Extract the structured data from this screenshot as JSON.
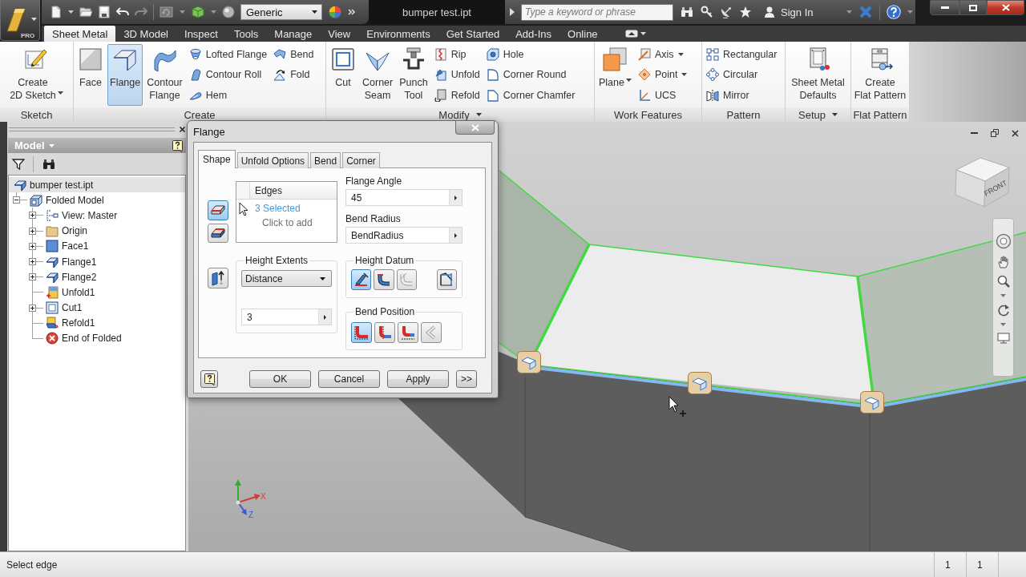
{
  "title_bar": {
    "app_badge": "PRO",
    "material": "Generic",
    "document_title": "bumper test.ipt",
    "search": {
      "placeholder": "Type a keyword or phrase"
    },
    "sign_in": "Sign In"
  },
  "ribbon_tabs": [
    {
      "label": "Sheet Metal",
      "selected": true
    },
    {
      "label": "3D Model",
      "selected": false
    },
    {
      "label": "Inspect",
      "selected": false
    },
    {
      "label": "Tools",
      "selected": false
    },
    {
      "label": "Manage",
      "selected": false
    },
    {
      "label": "View",
      "selected": false
    },
    {
      "label": "Environments",
      "selected": false
    },
    {
      "label": "Get Started",
      "selected": false
    },
    {
      "label": "Add-Ins",
      "selected": false
    },
    {
      "label": "Online",
      "selected": false
    }
  ],
  "ribbon_panels": [
    {
      "label": "Sketch",
      "dropdown": false,
      "tools": [
        {
          "label": "Create\n2D Sketch",
          "kind": "large",
          "active": false,
          "dropdown": true
        }
      ]
    },
    {
      "label": "Create",
      "dropdown": false,
      "tools": [
        {
          "label": "Face",
          "kind": "large",
          "active": false
        },
        {
          "label": "Flange",
          "kind": "large",
          "active": true
        },
        {
          "label": "Contour\nFlange",
          "kind": "large",
          "active": false
        },
        {
          "label": "Lofted Flange",
          "kind": "small",
          "active": false
        },
        {
          "label": "Contour Roll",
          "kind": "small",
          "active": false
        },
        {
          "label": "Hem",
          "kind": "small",
          "active": false
        },
        {
          "label": "Bend",
          "kind": "small",
          "active": false
        },
        {
          "label": "Fold",
          "kind": "small",
          "active": false
        }
      ]
    },
    {
      "label": "Modify",
      "dropdown": true,
      "tools": [
        {
          "label": "Cut",
          "kind": "large",
          "active": false
        },
        {
          "label": "Corner\nSeam",
          "kind": "large",
          "active": false
        },
        {
          "label": "Punch\nTool",
          "kind": "large",
          "active": false
        },
        {
          "label": "Rip",
          "kind": "small",
          "active": false
        },
        {
          "label": "Unfold",
          "kind": "small",
          "active": false
        },
        {
          "label": "Refold",
          "kind": "small",
          "active": false
        },
        {
          "label": "Hole",
          "kind": "small",
          "active": false
        },
        {
          "label": "Corner Round",
          "kind": "small",
          "active": false
        },
        {
          "label": "Corner Chamfer",
          "kind": "small",
          "active": false
        }
      ]
    },
    {
      "label": "Work Features",
      "dropdown": false,
      "tools": [
        {
          "label": "Plane",
          "kind": "large",
          "active": false,
          "dropdown": true
        },
        {
          "label": "Axis",
          "kind": "small",
          "active": false,
          "dropdown": true
        },
        {
          "label": "Point",
          "kind": "small",
          "active": false,
          "dropdown": true
        },
        {
          "label": "UCS",
          "kind": "small",
          "active": false
        }
      ]
    },
    {
      "label": "Pattern",
      "dropdown": false,
      "tools": [
        {
          "label": "Rectangular",
          "kind": "small",
          "active": false
        },
        {
          "label": "Circular",
          "kind": "small",
          "active": false
        },
        {
          "label": "Mirror",
          "kind": "small",
          "active": false
        }
      ]
    },
    {
      "label": "Setup",
      "dropdown": true,
      "tools": [
        {
          "label": "Sheet Metal\nDefaults",
          "kind": "large",
          "active": false
        }
      ]
    },
    {
      "label": "Flat Pattern",
      "dropdown": false,
      "tools": [
        {
          "label": "Create\nFlat Pattern",
          "kind": "large",
          "active": false
        }
      ]
    }
  ],
  "browser": {
    "title": "Model",
    "tree": [
      {
        "label": "bumper test.ipt",
        "kind": "part",
        "children": [
          {
            "label": "Folded Model",
            "kind": "folded-model",
            "expanded": true,
            "children": [
              {
                "label": "View: Master",
                "kind": "view",
                "expanded": false
              },
              {
                "label": "Origin",
                "kind": "origin",
                "expanded": false
              },
              {
                "label": "Face1",
                "kind": "face",
                "expanded": false
              },
              {
                "label": "Flange1",
                "kind": "flange",
                "expanded": false
              },
              {
                "label": "Flange2",
                "kind": "flange",
                "expanded": false
              },
              {
                "label": "Unfold1",
                "kind": "unfold"
              },
              {
                "label": "Cut1",
                "kind": "cut",
                "expanded": false
              },
              {
                "label": "Refold1",
                "kind": "refold"
              },
              {
                "label": "End of Folded",
                "kind": "end"
              }
            ]
          }
        ]
      }
    ]
  },
  "viewport": {
    "view_cube_label": "FRONT",
    "axis_labels": [
      "X",
      "Z"
    ]
  },
  "dialog": {
    "title": "Flange",
    "tabs": [
      {
        "label": "Shape",
        "selected": true
      },
      {
        "label": "Unfold Options",
        "selected": false
      },
      {
        "label": "Bend",
        "selected": false
      },
      {
        "label": "Corner",
        "selected": false
      }
    ],
    "edge_selectors": [
      {
        "kind": "add",
        "selected": true
      },
      {
        "kind": "remove",
        "selected": false
      }
    ],
    "edges": {
      "header": "Edges",
      "selection": "3 Selected",
      "hint": "Click to add"
    },
    "flange_angle": {
      "label": "Flange Angle",
      "value": "45"
    },
    "bend_radius": {
      "label": "Bend Radius",
      "value": "BendRadius"
    },
    "height_extents": {
      "label": "Height Extents",
      "mode": "Distance",
      "value": "3"
    },
    "height_datum": {
      "label": "Height Datum",
      "options": [
        {
          "selected": true,
          "disabled": false
        },
        {
          "selected": false,
          "disabled": false
        },
        {
          "selected": false,
          "disabled": true
        },
        {
          "selected": false,
          "disabled": false
        }
      ]
    },
    "bend_position": {
      "label": "Bend Position",
      "options": [
        {
          "selected": true,
          "disabled": false
        },
        {
          "selected": false,
          "disabled": false
        },
        {
          "selected": false,
          "disabled": false
        },
        {
          "selected": false,
          "disabled": true
        }
      ]
    },
    "buttons": [
      "OK",
      "Cancel",
      "Apply",
      ">>"
    ]
  },
  "status_bar": {
    "prompt": "Select edge",
    "counters": [
      "1",
      "1"
    ]
  }
}
